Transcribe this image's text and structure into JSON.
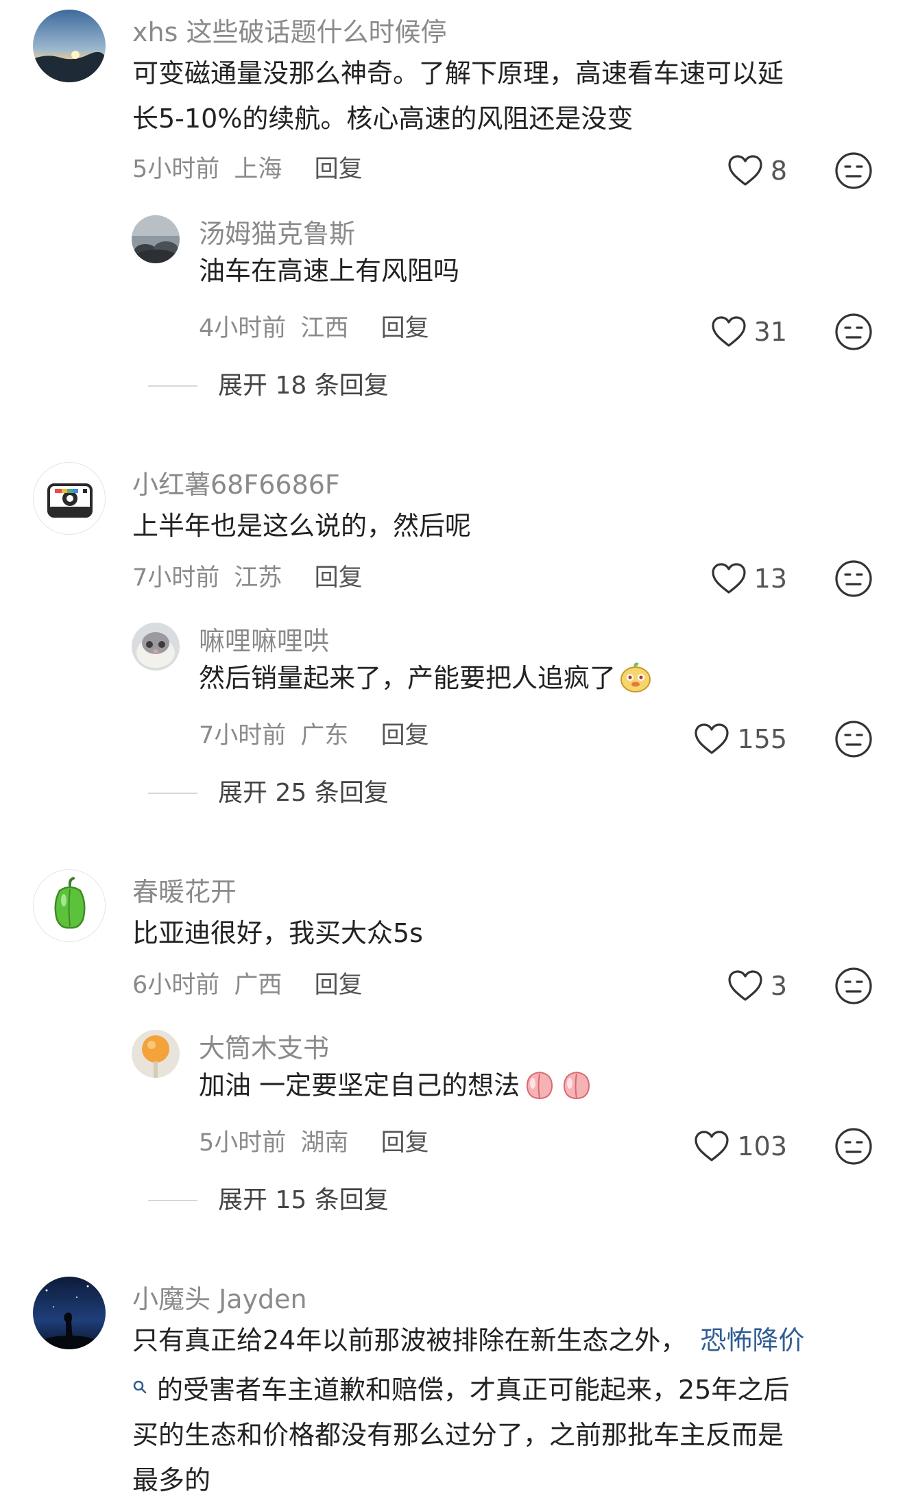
{
  "comments": [
    {
      "user": "xhs 这些破话题什么时候停",
      "lines": [
        "可变磁通量没那么神奇。了解下原理，高速看车速可以延",
        "长5-10%的续航。核心高速的风阻还是没变"
      ],
      "time": "5小时前",
      "location": "上海",
      "reply": "回复",
      "likes": "8",
      "replies": [
        {
          "user": "汤姆猫克鲁斯",
          "text": "油车在高速上有风阻吗",
          "time": "4小时前",
          "location": "江西",
          "reply": "回复",
          "likes": "31"
        }
      ],
      "expand": "展开 18 条回复"
    },
    {
      "user": "小红薯68F6686F",
      "lines": [
        "上半年也是这么说的，然后呢"
      ],
      "time": "7小时前",
      "location": "江苏",
      "reply": "回复",
      "likes": "13",
      "replies": [
        {
          "user": "嘛哩嘛哩哄",
          "text": "然后销量起来了，产能要把人追疯了",
          "time": "7小时前",
          "location": "广东",
          "reply": "回复",
          "likes": "155"
        }
      ],
      "expand": "展开 25 条回复"
    },
    {
      "user": "春暖花开",
      "lines": [
        "比亚迪很好，我买大众5s"
      ],
      "time": "6小时前",
      "location": "广西",
      "reply": "回复",
      "likes": "3",
      "replies": [
        {
          "user": "大筒木支书",
          "text": "加油 一定要坚定自己的想法",
          "time": "5小时前",
          "location": "湖南",
          "reply": "回复",
          "likes": "103"
        }
      ],
      "expand": "展开 15 条回复"
    },
    {
      "user": "小魔头 Jayden",
      "line1": "只有真正给24年以前那波被排除在新生态之外，",
      "link": "恐怖降价",
      "line2": "的受害者车主道歉和赔偿，才真正可能起来，25年之后",
      "line3": "买的生态和价格都没有那么过分了，之前那批车主反而是",
      "line4": "最多的"
    }
  ],
  "icons": {
    "like": "heart-outline-icon",
    "dislike": "neutral-face-icon",
    "link_search": "search-icon"
  },
  "colors": {
    "username": "#8a8a8a",
    "body": "#222222",
    "meta": "#8a8a8a",
    "link": "#2f5d94",
    "icon": "#333333"
  }
}
